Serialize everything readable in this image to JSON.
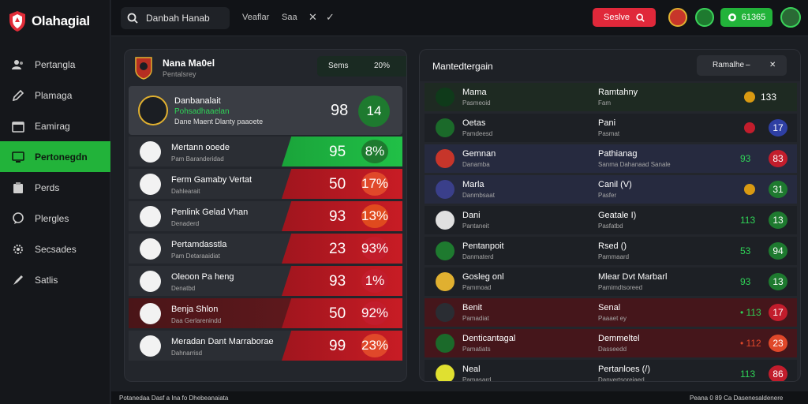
{
  "app": {
    "title": "Olahagial"
  },
  "sidebar": {
    "items": [
      {
        "label": "Pertangla",
        "icon": "users-icon"
      },
      {
        "label": "Plamaga",
        "icon": "pencil-icon"
      },
      {
        "label": "Eamirag",
        "icon": "calendar-icon"
      },
      {
        "label": "Pertonegdn",
        "icon": "monitor-icon",
        "active": true
      },
      {
        "label": "Perds",
        "icon": "clipboard-icon"
      },
      {
        "label": "Plergles",
        "icon": "chat-icon"
      },
      {
        "label": "Secsades",
        "icon": "gear-icon"
      },
      {
        "label": "Satlis",
        "icon": "pen-icon"
      }
    ]
  },
  "topbar": {
    "search_value": "Danbah Hanab",
    "link1": "Veaflar",
    "link2": "Saa",
    "red_button": "Seslve",
    "green_button": "61365"
  },
  "left_panel": {
    "title": "Nana Ma0el",
    "subtitle": "Pentalsrey",
    "pill_left": "Sems",
    "pill_right": "20%",
    "featured": {
      "title": "Danbanalait",
      "link": "Pohsadhaaelan",
      "desc": "Dane Maent Dlanty paaoete",
      "score": "98",
      "pct": "14"
    },
    "rows": [
      {
        "name": "Mertann ooede",
        "sub": "Pam Baranderidad",
        "score": "95",
        "pct": "8%",
        "bar": "green",
        "pctColor": "#1e7a2f"
      },
      {
        "name": "Ferm Gamaby Vertat",
        "sub": "Dahlearait",
        "score": "50",
        "pct": "17%",
        "bar": "red",
        "pctColor": "#e0482a"
      },
      {
        "name": "Penlink Gelad Vhan",
        "sub": "Denaderd",
        "score": "93",
        "pct": "13%",
        "bar": "red",
        "pctColor": "#e04a1e"
      },
      {
        "name": "Pertamdasstla",
        "sub": "Pam Detaraaidiat",
        "score": "23",
        "pct": "93%",
        "bar": "red",
        "pctColor": "#c21d2c"
      },
      {
        "name": "Oleoon Pa heng",
        "sub": "Denatbd",
        "score": "93",
        "pct": "1%",
        "bar": "red",
        "pctColor": "#c21d2c"
      },
      {
        "name": "Benja Shlon",
        "sub": "Daa Gerlarenindd",
        "score": "50",
        "pct": "92%",
        "bar": "red",
        "pctColor": "#c21d2c",
        "redrow": true
      },
      {
        "name": "Meradan Dant Marraborae",
        "sub": "Dahnarrisd",
        "score": "99",
        "pct": "23%",
        "bar": "red",
        "pctColor": "#e0482a"
      }
    ]
  },
  "right_panel": {
    "title": "Mantedtergain",
    "dropdown": "Ramalhe",
    "rows": [
      {
        "n1": "Mama",
        "s1": "Pasmeoid",
        "n2": "Ramtahny",
        "s2": "Fam",
        "dot": "#d99a12",
        "val": "133",
        "chip": "",
        "chipColor": "",
        "valColor": "#ffffff",
        "tone": "green-t"
      },
      {
        "n1": "Oetas",
        "s1": "Pamdeesd",
        "n2": "Pani",
        "s2": "Pasmat",
        "dot": "#c21d2c",
        "val": "",
        "chip": "17",
        "chipColor": "#2e3fa3",
        "valColor": "#ffffff",
        "tone": "dark-t"
      },
      {
        "n1": "Gemnan",
        "s1": "Danamba",
        "n2": "Pathianag",
        "s2": "Sanma Dahanaad Sanale",
        "dot": "",
        "val": "93",
        "chip": "83",
        "chipColor": "#c21d2c",
        "valColor": "#2fd357",
        "tone": "blue-t"
      },
      {
        "n1": "Marla",
        "s1": "Danmbsaat",
        "n2": "Canil (V)",
        "s2": "Pasfer",
        "dot": "#d99a12",
        "val": "",
        "chip": "31",
        "chipColor": "#1e7a2f",
        "valColor": "#ffffff",
        "tone": "blue-t"
      },
      {
        "n1": "Dani",
        "s1": "Pantaneit",
        "n2": "Geatale I)",
        "s2": "Pasfatbd",
        "dot": "",
        "val": "113",
        "chip": "13",
        "chipColor": "#1e7a2f",
        "valColor": "#2fd357",
        "tone": "dark-t"
      },
      {
        "n1": "Pentanpoit",
        "s1": "Danmaterd",
        "n2": "Rsed ()",
        "s2": "Pammaard",
        "dot": "",
        "val": "53",
        "chip": "94",
        "chipColor": "#1e7a2f",
        "valColor": "#2fd357",
        "tone": "dark-t"
      },
      {
        "n1": "Gosleg onl",
        "s1": "Pammoad",
        "n2": "Mlear Dvt Marbarl",
        "s2": "Pamimdtsoreed",
        "dot": "",
        "val": "93",
        "chip": "13",
        "chipColor": "#1e7a2f",
        "valColor": "#2fd357",
        "tone": "dark-t"
      },
      {
        "n1": "Benit",
        "s1": "Pamadiat",
        "n2": "Senal",
        "s2": "Paaaet ey",
        "dot": "",
        "val": "• 113",
        "chip": "17",
        "chipColor": "#c21d2c",
        "valColor": "#2fd357",
        "tone": "red-t"
      },
      {
        "n1": "Denticantagal",
        "s1": "Pamatiats",
        "n2": "Demmeltel",
        "s2": "Dasseedd",
        "dot": "",
        "val": "• 112",
        "chip": "23",
        "chipColor": "#e0482a",
        "valColor": "#e0482a",
        "tone": "red-t"
      },
      {
        "n1": "Neal",
        "s1": "Pamasard",
        "n2": "Pertanloes (/)",
        "s2": "Danvertsoreiaed",
        "dot": "",
        "val": "113",
        "chip": "86",
        "chipColor": "#c21d2c",
        "valColor": "#2fd357",
        "tone": "dark-t"
      }
    ]
  },
  "statusbar": {
    "left": "Potanedaa Dasf a Ina fo Dhebeanaiata",
    "right": "Peana 0 89 Ca Dasenesaldenere"
  }
}
